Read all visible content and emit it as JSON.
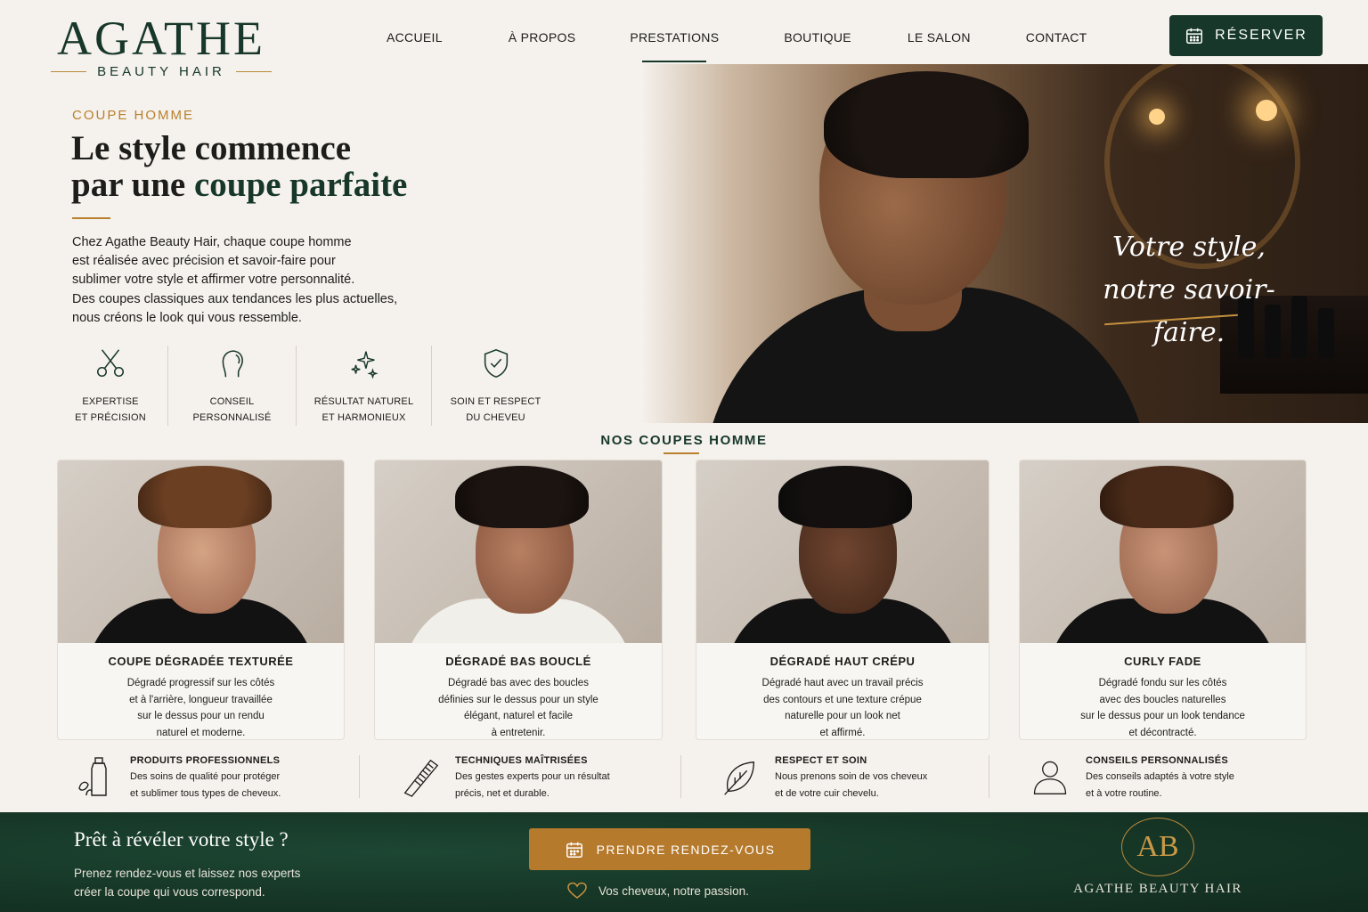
{
  "brand": {
    "name": "AGATHE",
    "tagline": "BEAUTY HAIR"
  },
  "nav": {
    "items": [
      {
        "label": "ACCUEIL"
      },
      {
        "label": "À PROPOS"
      },
      {
        "label": "PRESTATIONS",
        "active": true
      },
      {
        "label": "BOUTIQUE"
      },
      {
        "label": "LE SALON"
      },
      {
        "label": "CONTACT"
      }
    ],
    "reserve_label": "RÉSERVER"
  },
  "hero": {
    "eyebrow": "COUPE HOMME",
    "title_line1": "Le style commence",
    "title_line2_plain": "par une ",
    "title_line2_accent": "coupe parfaite",
    "body": "Chez Agathe Beauty Hair, chaque coupe homme est réalisée avec précision et savoir-faire pour sublimer votre style et affirmer votre personnalité. Des coupes classiques aux tendances les plus actuelles, nous créons le look qui vous ressemble.",
    "body_lines": [
      "Chez Agathe Beauty Hair, chaque coupe homme",
      "est réalisée avec précision et savoir-faire pour",
      "sublimer votre style et affirmer votre personnalité.",
      "Des coupes classiques aux tendances les plus actuelles,",
      "nous créons le look qui vous ressemble."
    ],
    "script_line1": "Votre style,",
    "script_line2": "notre savoir-faire.",
    "features": [
      {
        "icon": "scissors-icon",
        "line1": "EXPERTISE",
        "line2": "ET PRÉCISION"
      },
      {
        "icon": "head-profile-icon",
        "line1": "CONSEIL",
        "line2": "PERSONNALISÉ"
      },
      {
        "icon": "sparkles-icon",
        "line1": "RÉSULTAT NATUREL",
        "line2": "ET HARMONIEUX"
      },
      {
        "icon": "shield-check-icon",
        "line1": "SOIN ET RESPECT",
        "line2": "DU CHEVEU"
      }
    ]
  },
  "cuts": {
    "title": "NOS COUPES HOMME",
    "items": [
      {
        "title": "COUPE DÉGRADÉE TEXTURÉE",
        "desc": [
          "Dégradé progressif sur les côtés",
          "et à l'arrière, longueur travaillée",
          "sur le dessus pour un rendu",
          "naturel et moderne."
        ]
      },
      {
        "title": "DÉGRADÉ BAS BOUCLÉ",
        "desc": [
          "Dégradé bas avec des boucles",
          "définies sur le dessus pour un style",
          "élégant, naturel et facile",
          "à entretenir."
        ]
      },
      {
        "title": "DÉGRADÉ HAUT CRÉPU",
        "desc": [
          "Dégradé haut avec un travail précis",
          "des contours et une texture crépue",
          "naturelle pour un look net",
          "et affirmé."
        ]
      },
      {
        "title": "CURLY FADE",
        "desc": [
          "Dégradé fondu sur les côtés",
          "avec des boucles naturelles",
          "sur le dessus pour un look tendance",
          "et décontracté."
        ]
      }
    ]
  },
  "benefits": [
    {
      "icon": "product-bottle-icon",
      "title": "PRODUITS PROFESSIONNELS",
      "desc": [
        "Des soins de qualité pour protéger",
        "et sublimer tous types de cheveux."
      ]
    },
    {
      "icon": "comb-icon",
      "title": "TECHNIQUES MAÎTRISÉES",
      "desc": [
        "Des gestes experts pour un résultat",
        "précis, net et durable."
      ]
    },
    {
      "icon": "leaf-icon",
      "title": "RESPECT ET SOIN",
      "desc": [
        "Nous prenons soin de vos cheveux",
        "et de votre cuir chevelu."
      ]
    },
    {
      "icon": "user-icon",
      "title": "CONSEILS PERSONNALISÉS",
      "desc": [
        "Des conseils adaptés à votre style",
        "et à votre routine."
      ]
    }
  ],
  "cta": {
    "title": "Prêt à révéler votre style ?",
    "text_lines": [
      "Prenez rendez-vous et laissez nos experts",
      "créer la coupe qui vous correspond."
    ],
    "button_label": "PRENDRE RENDEZ-VOUS",
    "passion": "Vos cheveux, notre passion.",
    "monogram": "AB",
    "logo_name": "AGATHE BEAUTY HAIR"
  },
  "colors": {
    "brand_green": "#16372a",
    "accent_gold": "#b9802e",
    "background": "#f5f1ec"
  }
}
